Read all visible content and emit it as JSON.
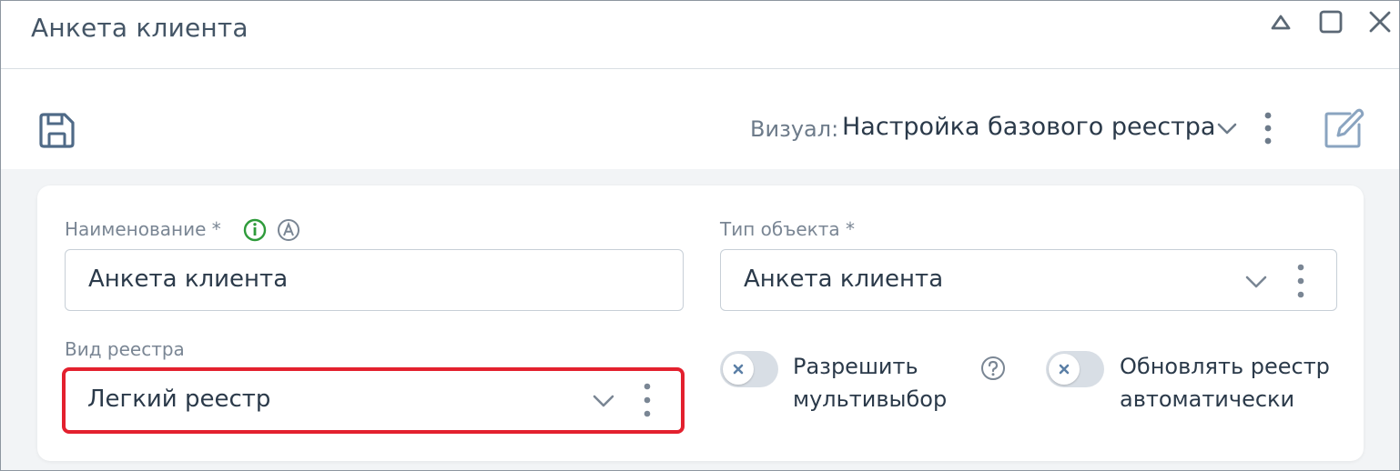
{
  "window": {
    "title": "Анкета клиента"
  },
  "toolbar": {
    "visual_label": "Визуал:",
    "visual_value": "Настройка базового реестра"
  },
  "form": {
    "name": {
      "label": "Наименование *",
      "value": "Анкета клиента"
    },
    "object_type": {
      "label": "Тип объекта *",
      "value": "Анкета клиента"
    },
    "registry_type": {
      "label": "Вид реестра",
      "value": "Легкий реестр"
    },
    "multiselect": {
      "label_line1": "Разрешить",
      "label_line2": "мультивыбор",
      "enabled": false
    },
    "auto_update": {
      "label_line1": "Обновлять реестр",
      "label_line2": "автоматически",
      "enabled": false
    }
  },
  "icons": {
    "name_info": "info-icon",
    "name_a": "letter-a-icon",
    "help": "question-icon"
  },
  "colors": {
    "highlight": "#e3202e",
    "info_green": "#2e9b3a",
    "accent_icon": "#5b7fa6"
  }
}
